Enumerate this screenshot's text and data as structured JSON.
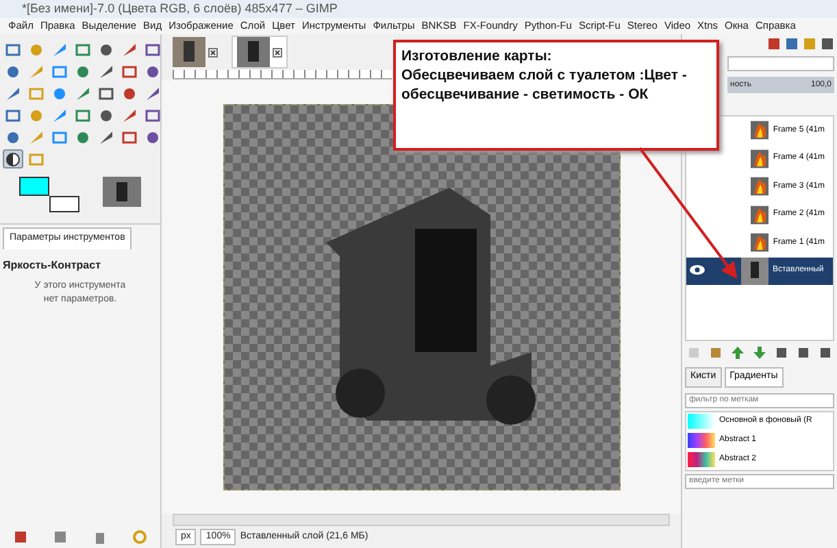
{
  "window": {
    "title": "*[Без имени]-7.0 (Цвета RGB, 6 слоёв) 485x477 – GIMP"
  },
  "menu": [
    "Файл",
    "Правка",
    "Выделение",
    "Вид",
    "Изображение",
    "Слой",
    "Цвет",
    "Инструменты",
    "Фильтры",
    "BNKSB",
    "FX-Foundry",
    "Python-Fu",
    "Script-Fu",
    "Stereo",
    "Video",
    "Xtns",
    "Окна",
    "Справка"
  ],
  "toolbox": {
    "tools": [
      {
        "selected": false
      },
      {
        "selected": false
      },
      {
        "selected": false
      },
      {
        "selected": false
      },
      {
        "selected": false
      },
      {
        "selected": false
      },
      {
        "selected": false
      },
      {
        "selected": false
      },
      {
        "selected": false
      },
      {
        "selected": false
      },
      {
        "selected": false
      },
      {
        "selected": false
      },
      {
        "selected": false
      },
      {
        "selected": false
      },
      {
        "selected": false
      },
      {
        "selected": false
      },
      {
        "selected": false
      },
      {
        "selected": false
      },
      {
        "selected": false
      },
      {
        "selected": false
      },
      {
        "selected": false
      },
      {
        "selected": false
      },
      {
        "selected": false
      },
      {
        "selected": false
      },
      {
        "selected": false
      },
      {
        "selected": false
      },
      {
        "selected": false
      },
      {
        "selected": false
      },
      {
        "selected": false
      },
      {
        "selected": false
      },
      {
        "selected": false
      },
      {
        "selected": false
      },
      {
        "selected": false
      },
      {
        "selected": false
      },
      {
        "selected": false
      },
      {
        "selected": true
      },
      {
        "selected": false
      }
    ]
  },
  "tool_options": {
    "tab": "Параметры инструментов",
    "tool_name": "Яркость-Контраст",
    "message": "У этого инструмента нет параметров."
  },
  "image_tabs": [
    {
      "selected": false
    },
    {
      "selected": true
    }
  ],
  "status_bar": {
    "unit": "px",
    "zoom": "100%",
    "message": "Вставленный слой (21,6 МБ)"
  },
  "layers_panel": {
    "opacity": {
      "label": "ность",
      "value": "100,0",
      "level": 1.0
    },
    "layers": [
      {
        "name": "Frame 5 (41m",
        "visible": false,
        "selected": false
      },
      {
        "name": "Frame 4 (41m",
        "visible": false,
        "selected": false
      },
      {
        "name": "Frame 3 (41m",
        "visible": false,
        "selected": false
      },
      {
        "name": "Frame 2 (41m",
        "visible": false,
        "selected": false
      },
      {
        "name": "Frame 1 (41m",
        "visible": false,
        "selected": false
      },
      {
        "name": "Вставленный",
        "visible": true,
        "selected": true
      }
    ]
  },
  "gradients_panel": {
    "tabs": [
      {
        "label": "Кисти",
        "selected": false
      },
      {
        "label": "Градиенты",
        "selected": true
      }
    ],
    "filter_placeholder": "фильтр по меткам",
    "gradients": [
      {
        "name": "Основной в фоновый (R",
        "kind": "fg-bg"
      },
      {
        "name": "Abstract 1",
        "kind": "abstract1"
      },
      {
        "name": "Abstract 2",
        "kind": "abstract2"
      }
    ],
    "tags_placeholder": "введите метки"
  },
  "callout": {
    "lines": [
      "Изготовление карты:",
      "Обесцвечиваем слой с туалетом :Цвет -",
      "обесцвечивание  - светимость - ОК"
    ]
  }
}
